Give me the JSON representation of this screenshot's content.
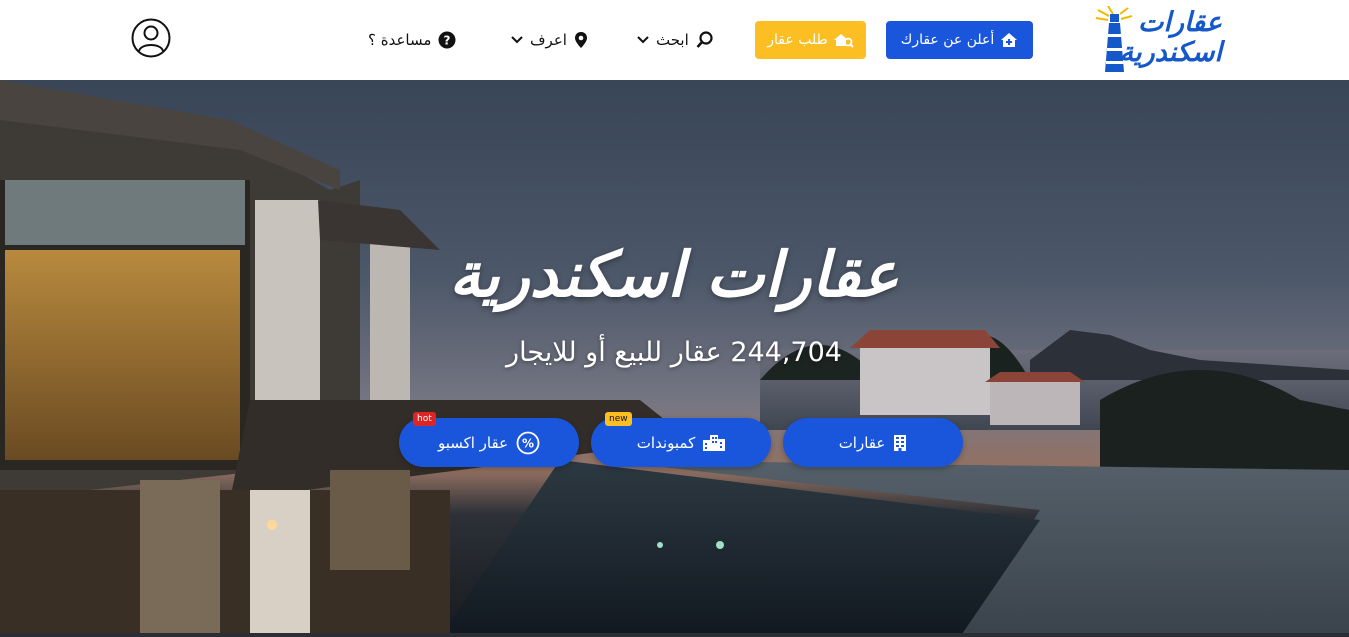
{
  "header": {
    "logo": {
      "line1": "عقارات",
      "line2": "اسكندرية"
    },
    "post_button": "أعلن عن عقارك",
    "request_button": "طلب عقار",
    "nav": {
      "search": "ابحث",
      "discover": "اعرف",
      "help": "مساعدة ؟"
    }
  },
  "hero": {
    "title": "عقارات اسكندرية",
    "subtitle": "244,704 عقار للبيع أو للايجار",
    "buttons": {
      "properties": "عقارات",
      "compounds": "كمبوندات",
      "compounds_badge": "new",
      "expo": "عقار اكسبو",
      "expo_badge": "hot"
    }
  },
  "colors": {
    "primary": "#1a56db",
    "warning": "#fbbf24",
    "badge_new": "#fbbf24",
    "badge_hot": "#dc2626"
  }
}
